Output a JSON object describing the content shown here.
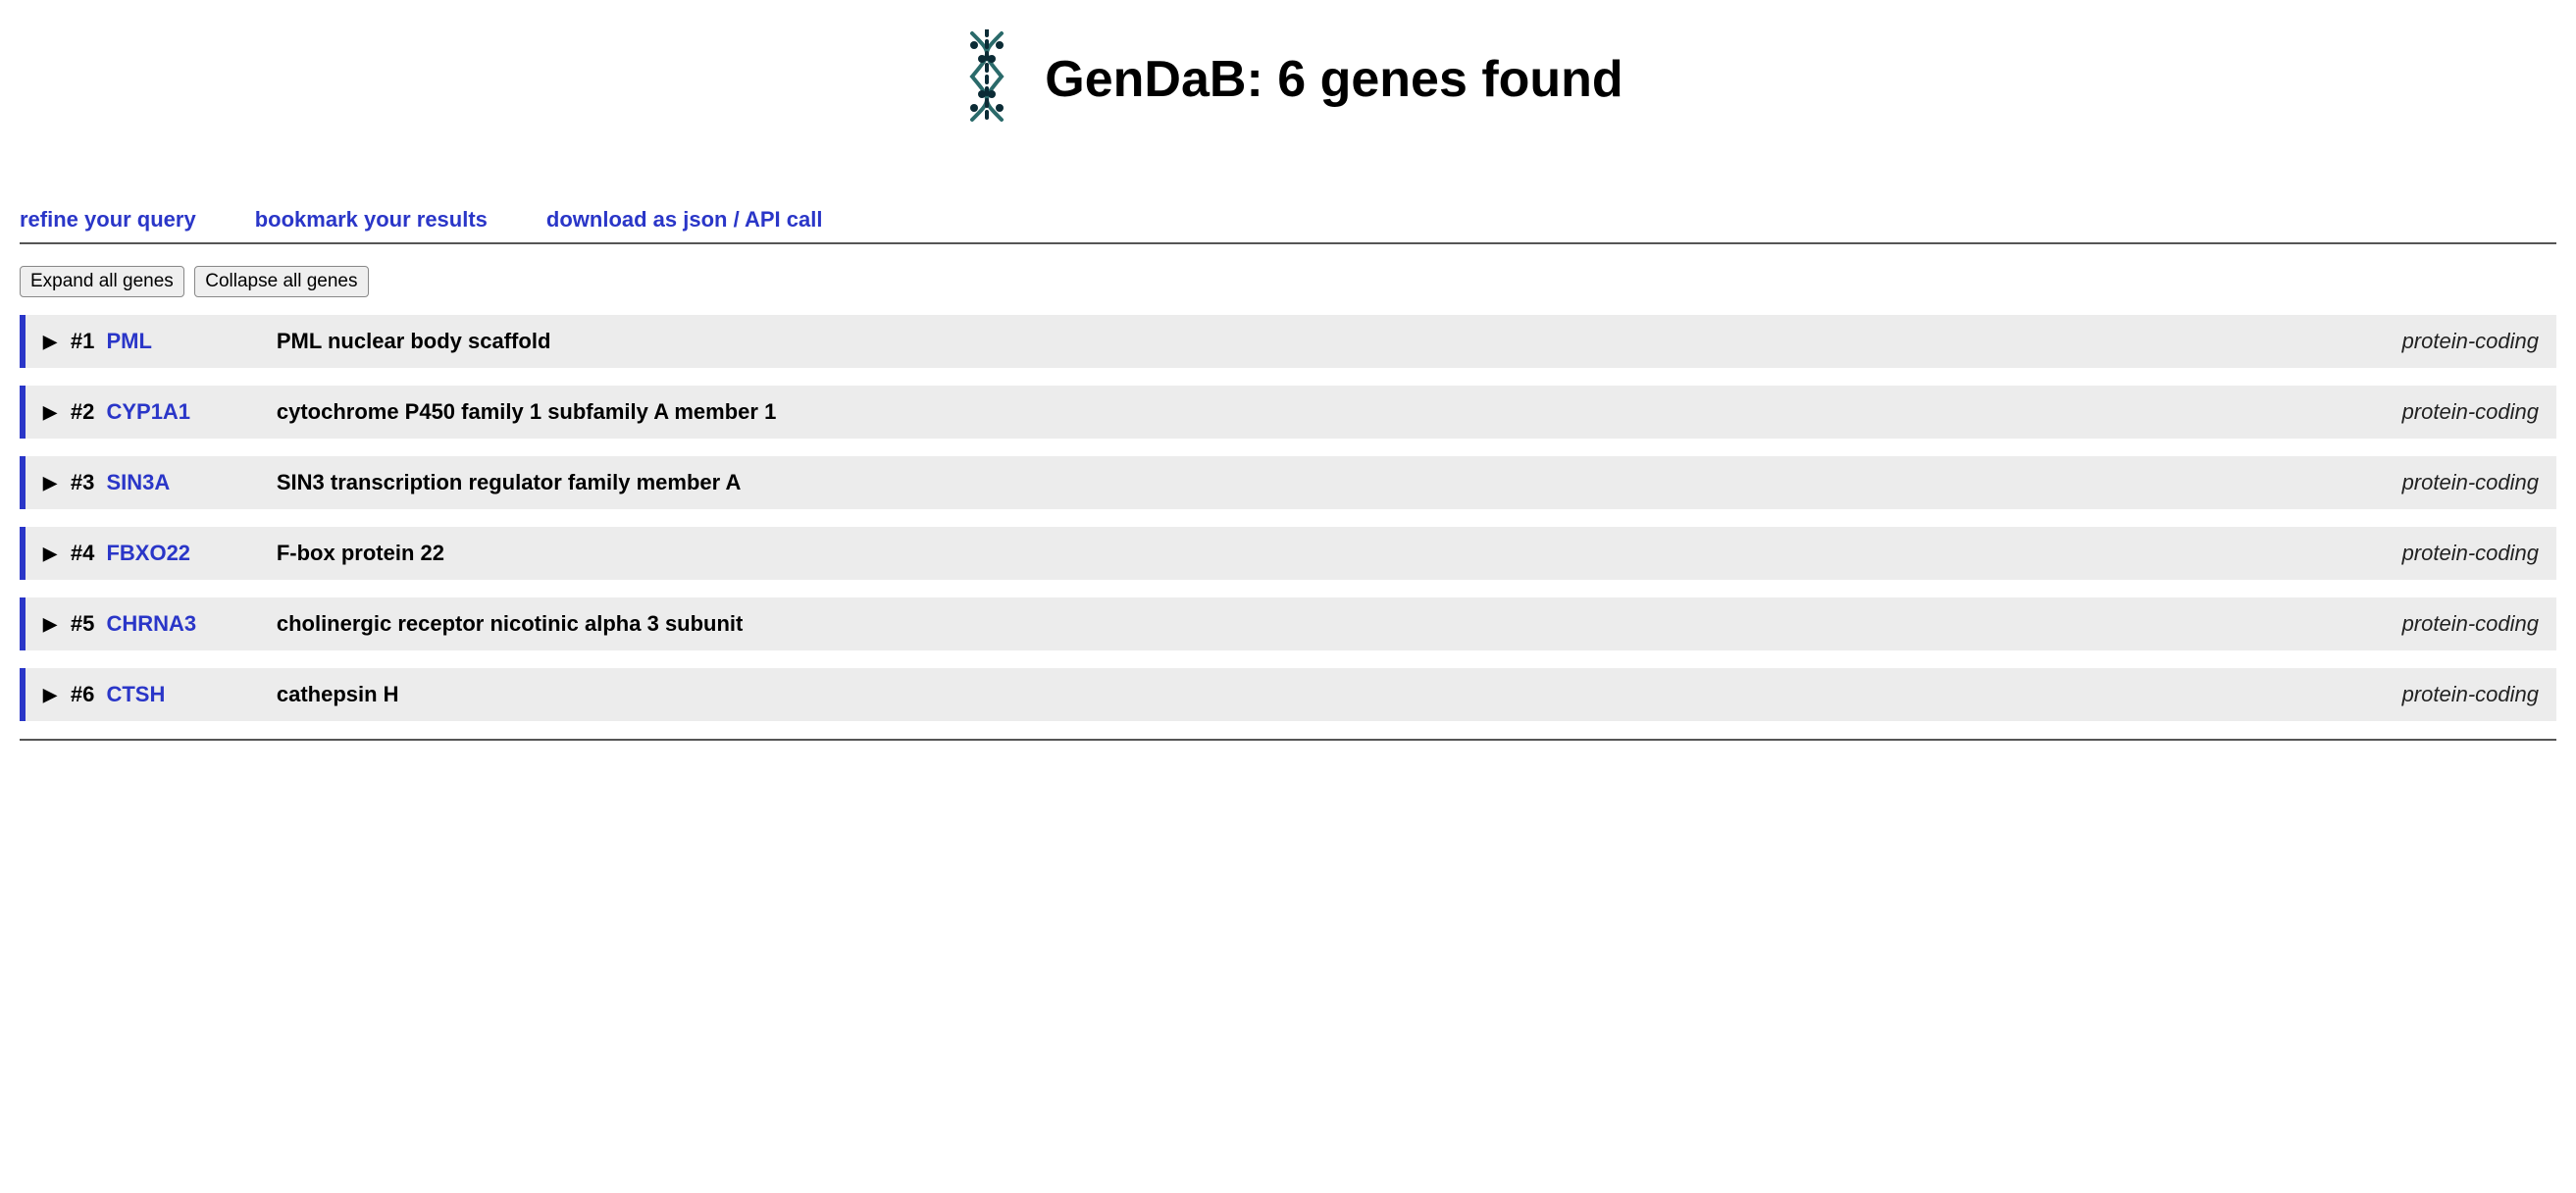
{
  "header": {
    "title": "GenDaB: 6 genes found"
  },
  "links": {
    "refine": "refine your query",
    "bookmark": "bookmark your results",
    "download": "download as json / API call"
  },
  "buttons": {
    "expand": "Expand all genes",
    "collapse": "Collapse all genes"
  },
  "genes": [
    {
      "idx": "#1",
      "symbol": "PML",
      "desc": "PML nuclear body scaffold",
      "type": "protein-coding"
    },
    {
      "idx": "#2",
      "symbol": "CYP1A1",
      "desc": "cytochrome P450 family 1 subfamily A member 1",
      "type": "protein-coding"
    },
    {
      "idx": "#3",
      "symbol": "SIN3A",
      "desc": "SIN3 transcription regulator family member A",
      "type": "protein-coding"
    },
    {
      "idx": "#4",
      "symbol": "FBXO22",
      "desc": "F-box protein 22",
      "type": "protein-coding"
    },
    {
      "idx": "#5",
      "symbol": "CHRNA3",
      "desc": "cholinergic receptor nicotinic alpha 3 subunit",
      "type": "protein-coding"
    },
    {
      "idx": "#6",
      "symbol": "CTSH",
      "desc": "cathepsin H",
      "type": "protein-coding"
    }
  ]
}
